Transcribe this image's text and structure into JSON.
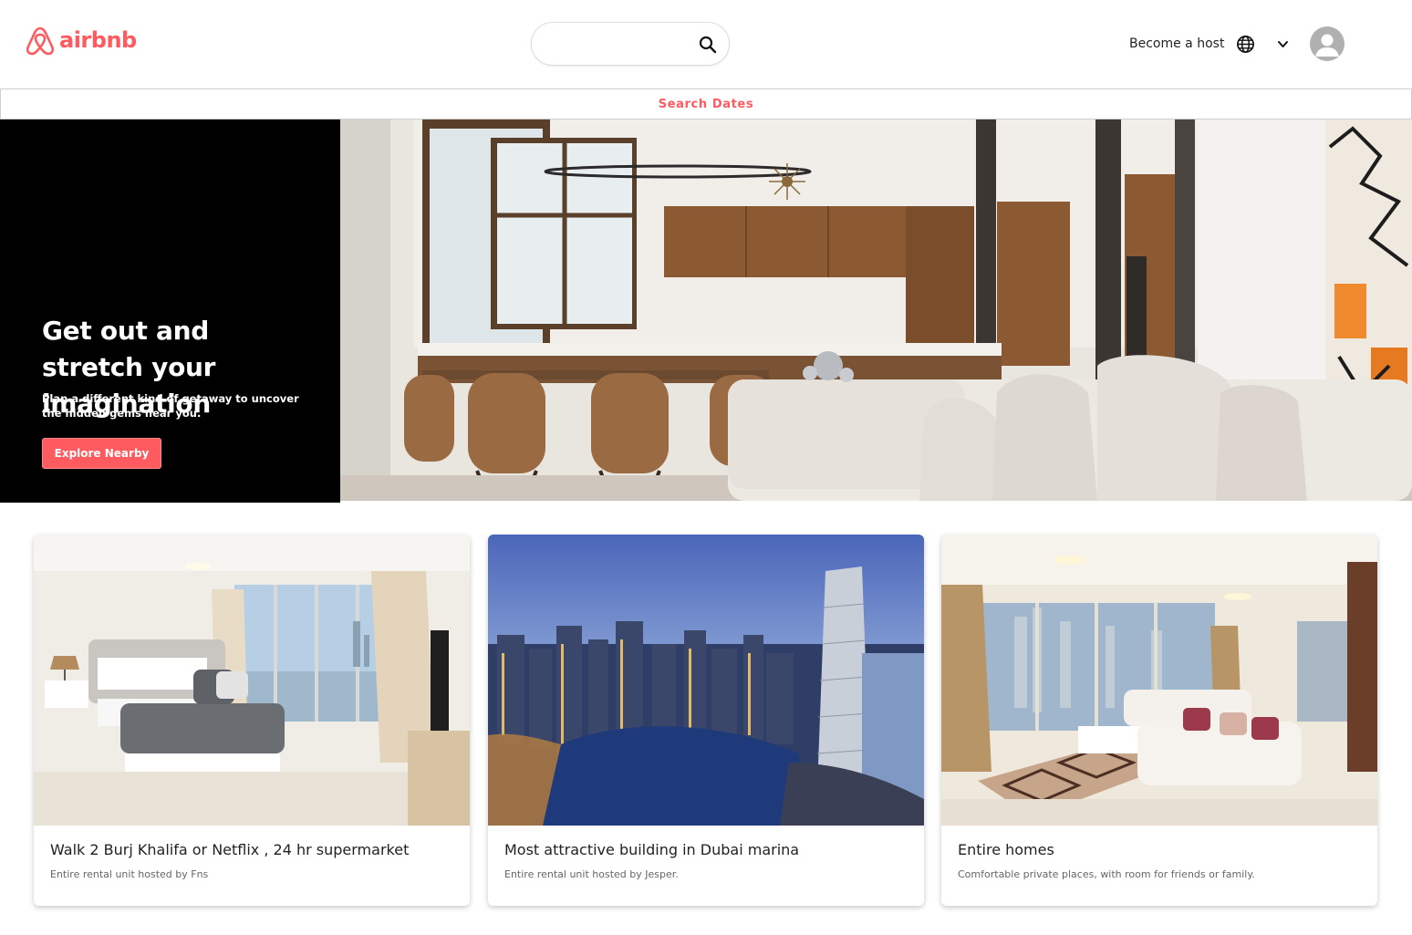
{
  "header": {
    "brand": "airbnb",
    "brand_color": "#ff5a5f",
    "search": {
      "value": "",
      "placeholder": ""
    },
    "become_host_label": "Become a host",
    "icons": [
      "airbnb-logo-icon",
      "search-icon",
      "globe-icon",
      "chevron-down-icon",
      "user-avatar-icon"
    ]
  },
  "dates_bar": {
    "label": "Search Dates"
  },
  "hero": {
    "title": "Get out and stretch your imagination",
    "subtitle": "Plan a different kind of getaway to uncover the hidden gems near you.",
    "button_label": "Explore Nearby"
  },
  "cards": [
    {
      "title": "Walk 2 Burj Khalifa or Netflix , 24 hr supermarket",
      "description": "Entire rental unit hosted by Fns"
    },
    {
      "title": "Most attractive building in Dubai marina",
      "description": "Entire rental unit hosted by Jesper."
    },
    {
      "title": "Entire homes",
      "description": "Comfortable private places, with room for friends or family."
    }
  ]
}
